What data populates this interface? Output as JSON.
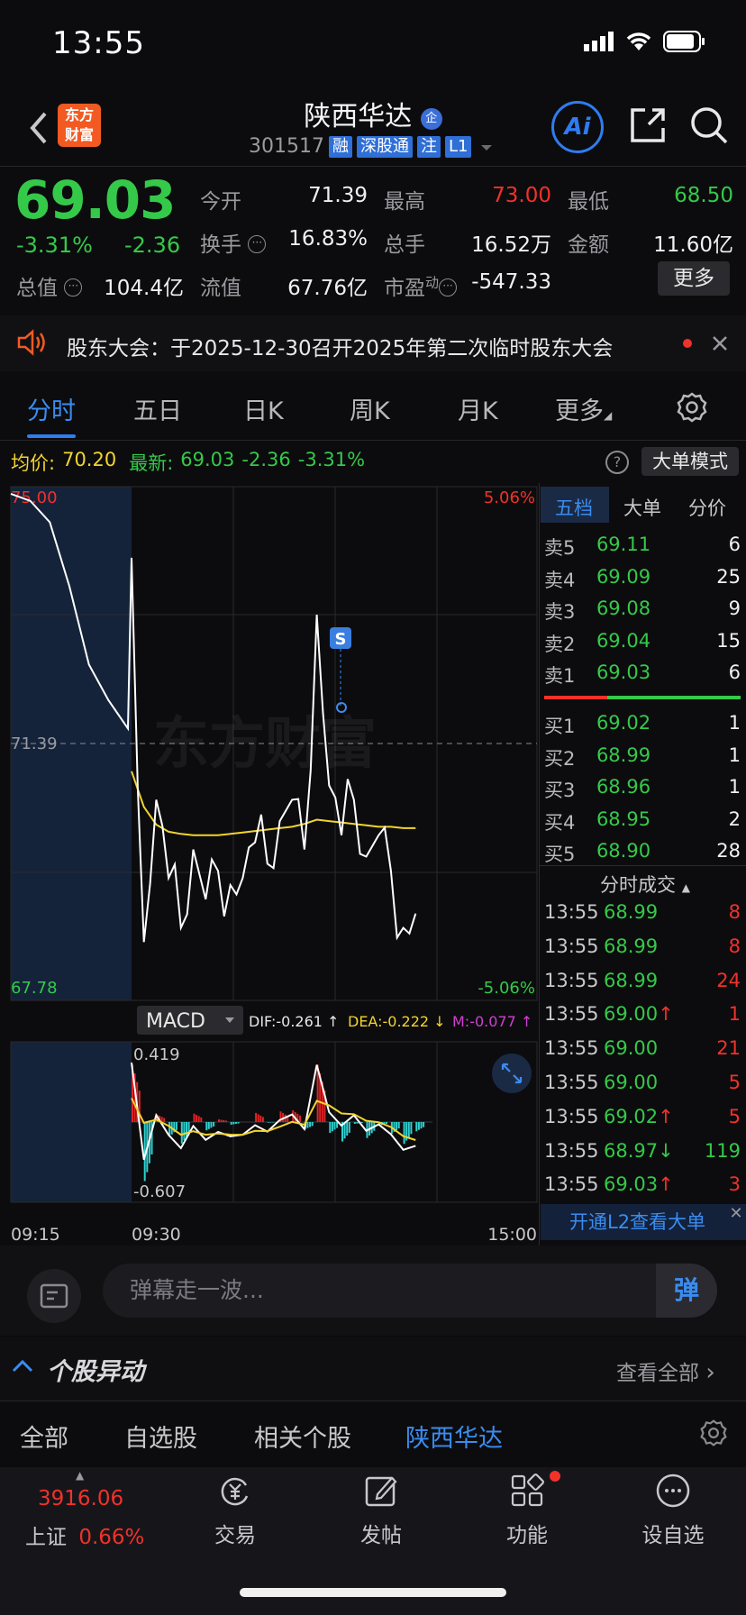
{
  "status": {
    "time": "13:55"
  },
  "header": {
    "logo_text_1": "东方",
    "logo_text_2": "财富",
    "stock_name": "陕西华达",
    "stock_code": "301517",
    "tags": [
      "融",
      "深股通",
      "注",
      "L1"
    ],
    "ai_label": "Ai"
  },
  "quote": {
    "price": "69.03",
    "change_pct": "-3.31%",
    "change_val": "-2.36",
    "fields": [
      {
        "label": "今开",
        "value": "71.39",
        "color": "#f0f0f0"
      },
      {
        "label": "最高",
        "value": "73.00",
        "color": "#f1312b"
      },
      {
        "label": "最低",
        "value": "68.50",
        "color": "#35c94a"
      },
      {
        "label": "换手",
        "value": "16.83%",
        "color": "#f0f0f0"
      },
      {
        "label": "总手",
        "value": "16.52万",
        "color": "#f0f0f0"
      },
      {
        "label": "金额",
        "value": "11.60亿",
        "color": "#f0f0f0"
      },
      {
        "label": "总值",
        "value": "104.4亿",
        "color": "#f0f0f0"
      },
      {
        "label": "流值",
        "value": "67.76亿",
        "color": "#f0f0f0"
      },
      {
        "label": "市盈",
        "value": "-547.33",
        "color": "#f0f0f0"
      }
    ],
    "pe_sup": "动",
    "more_label": "更多"
  },
  "notice": {
    "text": "股东大会：于2025-12-30召开2025年第二次临时股东大会"
  },
  "tabs": [
    "分时",
    "五日",
    "日K",
    "周K",
    "月K",
    "更多"
  ],
  "info_line": {
    "avg_label": "均价:",
    "avg_value": "70.20",
    "latest_label": "最新:",
    "latest_value": "69.03",
    "latest_change": "-2.36",
    "latest_pct": "-3.31%",
    "big_order_mode": "大单模式"
  },
  "chart": {
    "y_top_label": "75.00",
    "y_mid_label": "71.39",
    "y_bot_label": "67.78",
    "pct_top": "5.06%",
    "pct_bot": "-5.06%",
    "marker": "S",
    "watermark": "东方财富",
    "x_labels": [
      "09:15",
      "09:30",
      "15:00"
    ],
    "macd_label": "MACD",
    "dif": "DIF:-0.261",
    "dea": "DEA:-0.222",
    "m": "M:-0.077",
    "macd_top": "0.419",
    "macd_bot": "-0.607"
  },
  "chart_data": {
    "type": "line",
    "ylim": [
      67.78,
      75.0
    ],
    "baseline": 71.39,
    "series": [
      {
        "name": "价格",
        "values": [
          74.9,
          74.8,
          74.5,
          73.6,
          72.5,
          72.0,
          71.6,
          74.0,
          68.6,
          70.6,
          69.5,
          68.8,
          69.9,
          69.2,
          69.6,
          69.4,
          69.5,
          70.0,
          69.7,
          70.3,
          70.6,
          69.9,
          73.2,
          70.8,
          70.1,
          70.6,
          69.8,
          70.1,
          69.6,
          68.8,
          69.0
        ]
      },
      {
        "name": "均价",
        "values": [
          null,
          null,
          null,
          null,
          null,
          null,
          null,
          71.0,
          70.5,
          70.25,
          70.15,
          70.12,
          70.1,
          70.1,
          70.1,
          70.12,
          70.14,
          70.16,
          70.18,
          70.2,
          70.22,
          70.26,
          70.32,
          70.3,
          70.28,
          70.26,
          70.24,
          70.22,
          70.22,
          70.2,
          70.2
        ]
      }
    ]
  },
  "order_book": {
    "tabs": [
      "五档",
      "大单",
      "分价"
    ],
    "asks": [
      {
        "label": "卖5",
        "price": "69.11",
        "vol": "6"
      },
      {
        "label": "卖4",
        "price": "69.09",
        "vol": "25"
      },
      {
        "label": "卖3",
        "price": "69.08",
        "vol": "9"
      },
      {
        "label": "卖2",
        "price": "69.04",
        "vol": "15"
      },
      {
        "label": "卖1",
        "price": "69.03",
        "vol": "6"
      }
    ],
    "bids": [
      {
        "label": "买1",
        "price": "69.02",
        "vol": "1"
      },
      {
        "label": "买2",
        "price": "68.99",
        "vol": "1"
      },
      {
        "label": "买3",
        "price": "68.96",
        "vol": "1"
      },
      {
        "label": "买4",
        "price": "68.95",
        "vol": "2"
      },
      {
        "label": "买5",
        "price": "68.90",
        "vol": "28"
      }
    ],
    "trades_title": "分时成交",
    "trades": [
      {
        "time": "13:55",
        "price": "68.99",
        "arrow": "",
        "vol": "8",
        "vcolor": "#f1312b"
      },
      {
        "time": "13:55",
        "price": "68.99",
        "arrow": "",
        "vol": "8",
        "vcolor": "#f1312b"
      },
      {
        "time": "13:55",
        "price": "68.99",
        "arrow": "",
        "vol": "24",
        "vcolor": "#f1312b"
      },
      {
        "time": "13:55",
        "price": "69.00",
        "arrow": "↑",
        "vol": "1",
        "vcolor": "#f1312b"
      },
      {
        "time": "13:55",
        "price": "69.00",
        "arrow": "",
        "vol": "21",
        "vcolor": "#f1312b"
      },
      {
        "time": "13:55",
        "price": "69.00",
        "arrow": "",
        "vol": "5",
        "vcolor": "#f1312b"
      },
      {
        "time": "13:55",
        "price": "69.02",
        "arrow": "↑",
        "vol": "5",
        "vcolor": "#f1312b"
      },
      {
        "time": "13:55",
        "price": "68.97",
        "arrow": "↓",
        "vol": "119",
        "vcolor": "#35c94a"
      },
      {
        "time": "13:55",
        "price": "69.03",
        "arrow": "↑",
        "vol": "3",
        "vcolor": "#f1312b"
      }
    ],
    "l2_label": "开通L2查看大单"
  },
  "comment": {
    "placeholder": "弹幕走一波...",
    "danmu_label": "弹"
  },
  "abnormal": {
    "title": "个股异动",
    "view_all": "查看全部"
  },
  "sub_tabs": [
    "全部",
    "自选股",
    "相关个股",
    "陕西华达"
  ],
  "bottom_nav": {
    "index_value": "3916.06",
    "index_name": "上证",
    "index_pct": "0.66%",
    "items": [
      "交易",
      "发帖",
      "功能",
      "设自选"
    ]
  }
}
